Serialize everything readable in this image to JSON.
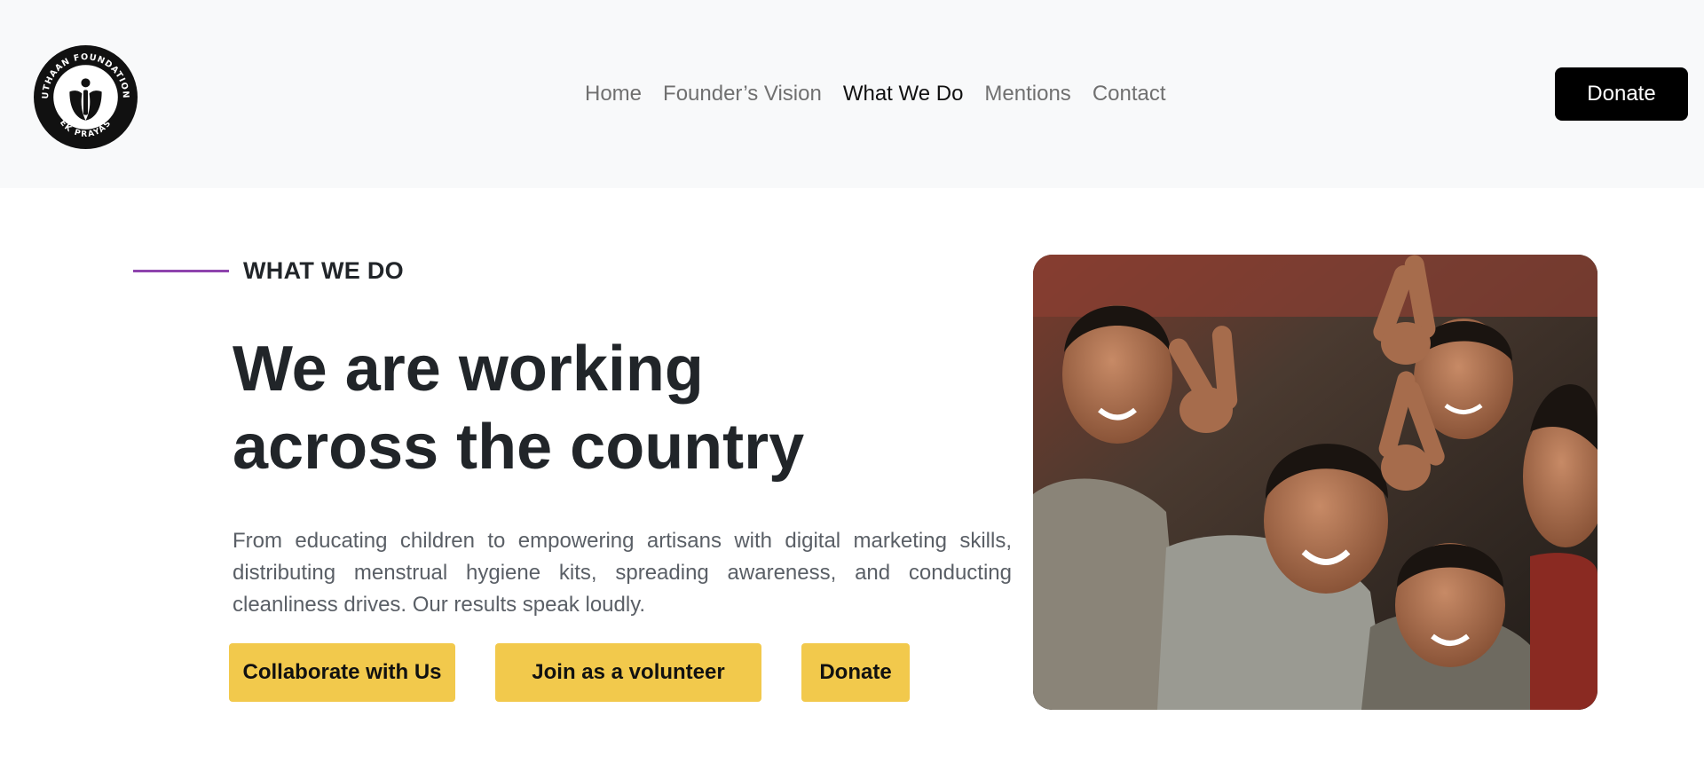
{
  "logo": {
    "top_text": "UTHAAN FOUNDATION",
    "bottom_text": "EK PRAYAS",
    "icon": "lotus-person-emblem"
  },
  "nav": {
    "items": [
      {
        "label": "Home",
        "active": false
      },
      {
        "label": "Founder’s Vision",
        "active": false
      },
      {
        "label": "What We Do",
        "active": true
      },
      {
        "label": "Mentions",
        "active": false
      },
      {
        "label": "Contact",
        "active": false
      }
    ],
    "donate_label": "Donate"
  },
  "hero": {
    "eyebrow": "WHAT WE DO",
    "heading_line1": "We are working",
    "heading_line2": "across the country",
    "description": "From educating children to empowering artisans with digital marketing skills, distributing menstrual hygiene kits, spreading awareness, and conducting cleanliness drives. Our results speak loudly.",
    "buttons": {
      "collaborate": "Collaborate with Us",
      "volunteer": "Join as a volunteer",
      "donate": "Donate"
    },
    "image_subject": "group of smiling children making peace signs"
  },
  "colors": {
    "accent_line": "#8e44ad",
    "cta_yellow": "#f2c94c",
    "topbar_bg": "#f8f9fa",
    "donate_top_bg": "#000000"
  }
}
